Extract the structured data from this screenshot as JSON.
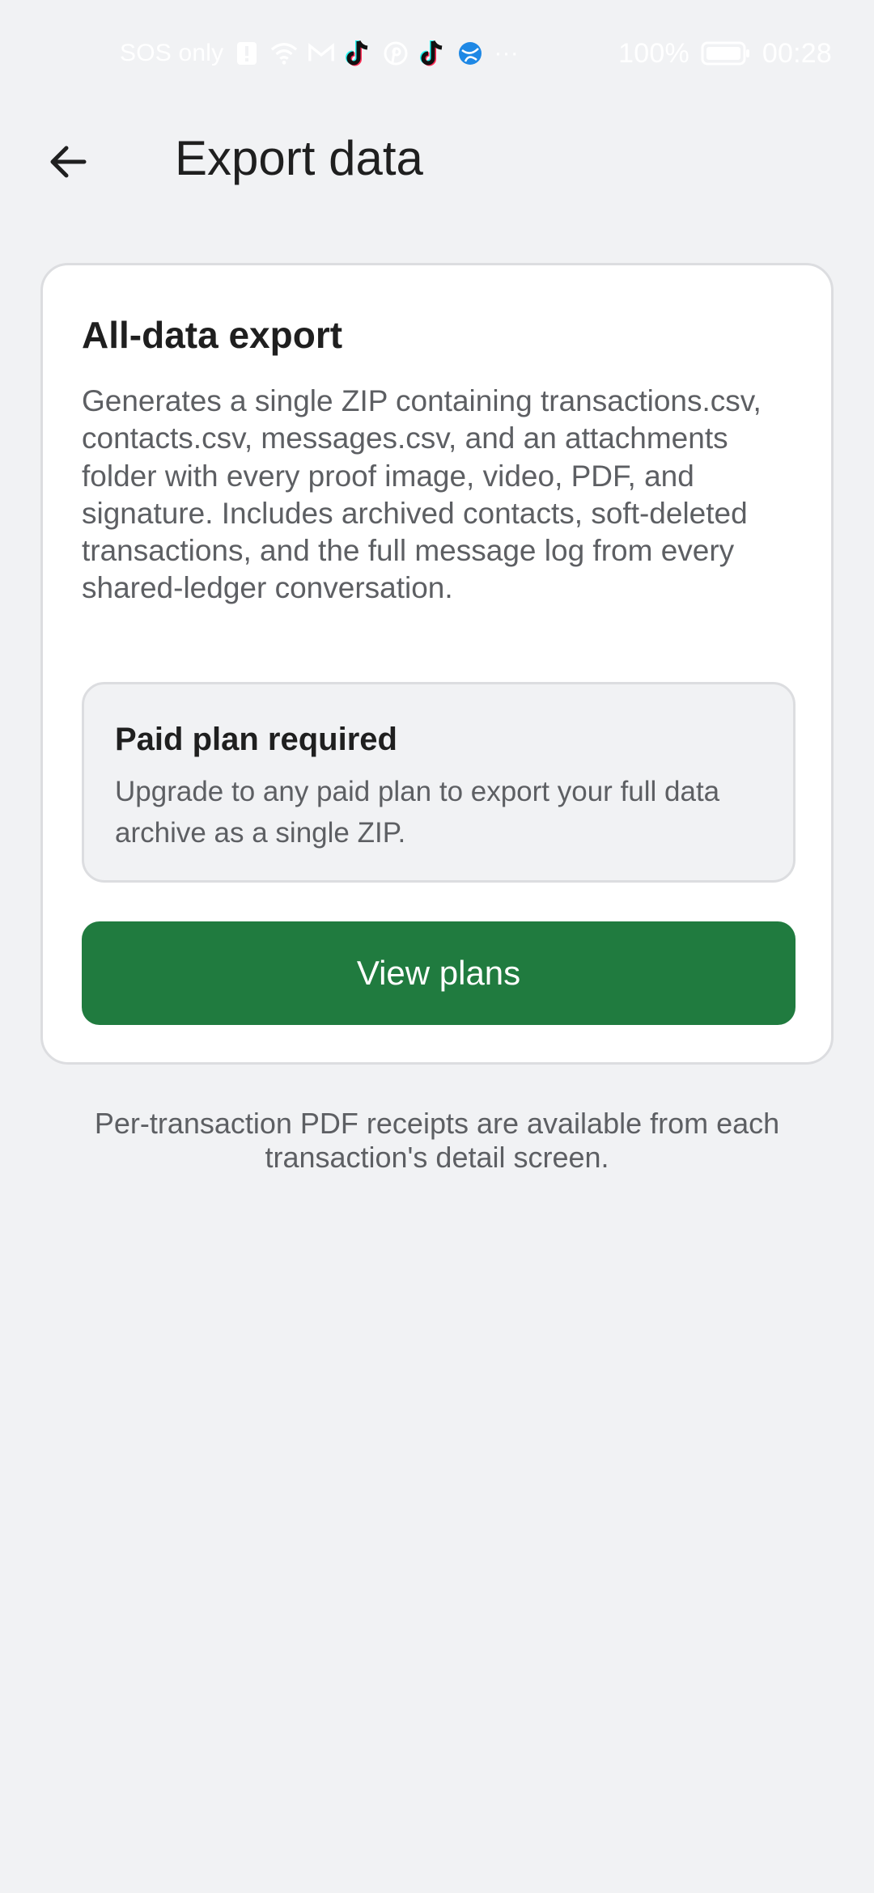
{
  "status_bar": {
    "carrier": "SOS only",
    "icons": [
      "alert-icon",
      "wifi-icon",
      "mail-icon",
      "tiktok-icon",
      "pinterest-icon",
      "tiktok-icon",
      "browser-icon",
      "more-icon"
    ],
    "more": "···",
    "battery": "100%",
    "time": "00:28"
  },
  "app_bar": {
    "back_icon": "arrow-left-icon",
    "title": "Export data"
  },
  "card": {
    "title": "All-data export",
    "description": "Generates a single ZIP containing transactions.csv, contacts.csv, messages.csv, and an attachments folder with every proof image, video, PDF, and signature. Includes archived contacts, soft-deleted transactions, and the full message log from every shared-ledger conversation.",
    "notice": {
      "title": "Paid plan required",
      "body": "Upgrade to any paid plan to export your full data archive as a single ZIP."
    },
    "button_label": "View plans"
  },
  "footnote": "Per-transaction PDF receipts are available from each transaction's detail screen.",
  "colors": {
    "background": "#f1f2f4",
    "card": "#ffffff",
    "accent": "#207b3f",
    "text_primary": "#1f1f1f",
    "text_secondary": "#5d5f63"
  }
}
